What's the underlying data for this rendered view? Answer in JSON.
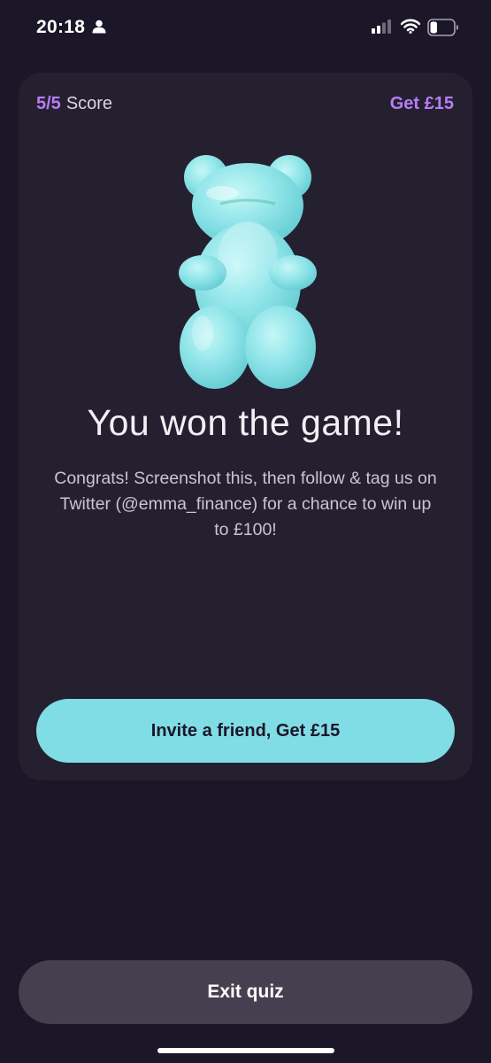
{
  "status_bar": {
    "time": "20:18",
    "icons": [
      "person-icon",
      "cellular-signal-icon",
      "wifi-icon",
      "battery-icon"
    ],
    "battery_level": 0.3
  },
  "card": {
    "score_value": "5/5",
    "score_label": "Score",
    "get_link": "Get £15",
    "image": "gummy-bear",
    "title": "You won the game!",
    "message": "Congrats! Screenshot this, then follow & tag us on Twitter (@emma_finance) for a chance to win up to £100!",
    "invite_button": "Invite a friend, Get £15"
  },
  "exit_button": "Exit quiz",
  "colors": {
    "background": "#1b1628",
    "card": "#25202f",
    "accent_purple": "#b77cf5",
    "accent_teal": "#80dde5",
    "exit_button": "#45404f"
  }
}
